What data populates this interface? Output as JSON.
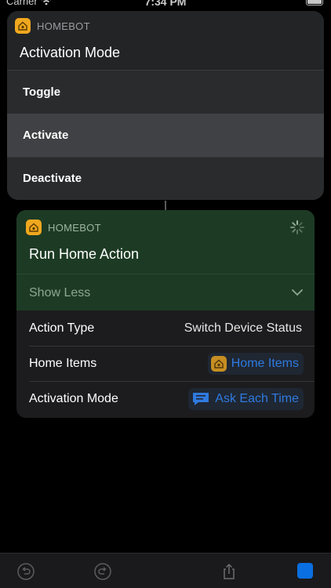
{
  "status_bar": {
    "carrier": "Carrier",
    "time": "7:34 PM"
  },
  "popup": {
    "app_name": "HOMEBOT",
    "title": "Activation Mode",
    "options": [
      {
        "label": "Toggle",
        "selected": false
      },
      {
        "label": "Activate",
        "selected": true
      },
      {
        "label": "Deactivate",
        "selected": false
      }
    ]
  },
  "action_card": {
    "app_name": "HOMEBOT",
    "title": "Run Home Action",
    "show_less": "Show Less",
    "params": [
      {
        "label": "Action Type",
        "value": "Switch Device Status"
      },
      {
        "label": "Home Items",
        "value": "Home Items",
        "icon": "homebot-app-icon"
      },
      {
        "label": "Activation Mode",
        "value": "Ask Each Time",
        "icon": "speech-bubble-icon"
      }
    ]
  },
  "toolbar": {
    "buttons": [
      "undo-icon",
      "redo-icon",
      "share-icon",
      "stop-icon"
    ]
  },
  "colors": {
    "accent_blue": "#2f7ae0",
    "homebot_orange": "#f0a81e",
    "card_green": "#1d3b24",
    "stop_blue": "#0a6fe0"
  }
}
